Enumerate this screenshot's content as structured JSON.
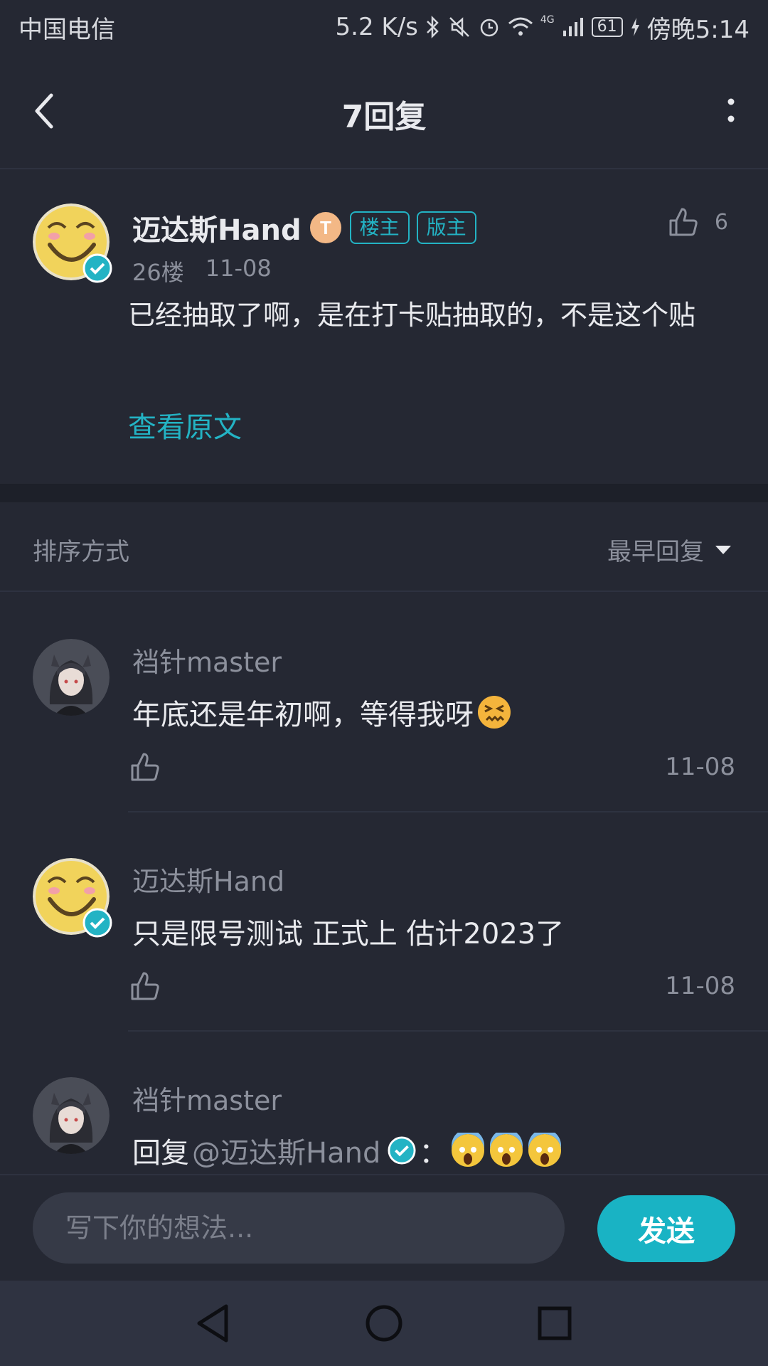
{
  "status_bar": {
    "carrier": "中国电信",
    "speed": "5.2 K/s",
    "network": "4G",
    "battery": "61",
    "time": "傍晚5:14"
  },
  "header": {
    "title": "7回复"
  },
  "post": {
    "author": "迈达斯Hand",
    "level_badge": "T",
    "tags": [
      "楼主",
      "版主"
    ],
    "likes": "6",
    "floor": "26楼",
    "date": "11-08",
    "content": "已经抽取了啊，是在打卡贴抽取的，不是这个贴",
    "view_original": "查看原文"
  },
  "sort": {
    "label": "排序方式",
    "selected": "最早回复"
  },
  "comments": [
    {
      "author": "裆针master",
      "text": "年底还是年初啊，等得我呀",
      "date": "11-08"
    },
    {
      "author": "迈达斯Hand",
      "text": "只是限号测试 正式上 估计2023了",
      "date": "11-08"
    },
    {
      "author": "裆针master",
      "reply_prefix": "回复",
      "mention": "@迈达斯Hand",
      "colon": "："
    }
  ],
  "input": {
    "placeholder": "写下你的想法...",
    "send_label": "发送"
  },
  "colors": {
    "accent": "#19b3c4",
    "background": "#252833"
  },
  "icons": [
    "back-icon",
    "more-icon",
    "thumbs-up-icon",
    "verified-icon",
    "dropdown-icon",
    "nav-back-icon",
    "nav-home-icon",
    "nav-recents-icon"
  ]
}
